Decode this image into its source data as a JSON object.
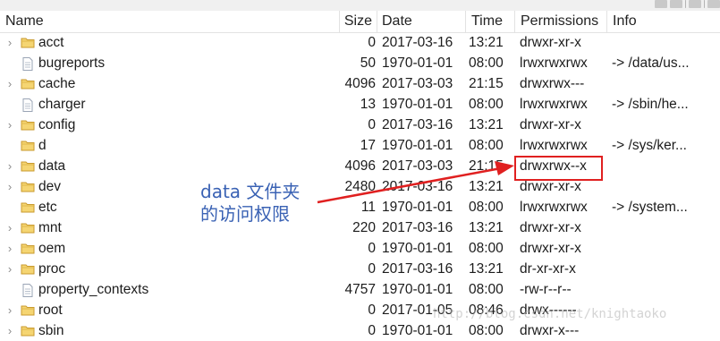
{
  "header": {
    "name": "Name",
    "size": "Size",
    "date": "Date",
    "time": "Time",
    "permissions": "Permissions",
    "info": "Info"
  },
  "rows": [
    {
      "name": "acct",
      "type": "folder",
      "size": "0",
      "date": "2017-03-16",
      "time": "13:21",
      "perm": "drwxr-xr-x",
      "info": ""
    },
    {
      "name": "bugreports",
      "type": "file",
      "size": "50",
      "date": "1970-01-01",
      "time": "08:00",
      "perm": "lrwxrwxrwx",
      "info": "-> /data/us..."
    },
    {
      "name": "cache",
      "type": "folder",
      "size": "4096",
      "date": "2017-03-03",
      "time": "21:15",
      "perm": "drwxrwx---",
      "info": ""
    },
    {
      "name": "charger",
      "type": "file",
      "size": "13",
      "date": "1970-01-01",
      "time": "08:00",
      "perm": "lrwxrwxrwx",
      "info": "-> /sbin/he..."
    },
    {
      "name": "config",
      "type": "folder",
      "size": "0",
      "date": "2017-03-16",
      "time": "13:21",
      "perm": "drwxr-xr-x",
      "info": ""
    },
    {
      "name": "d",
      "type": "folder-noexp",
      "size": "17",
      "date": "1970-01-01",
      "time": "08:00",
      "perm": "lrwxrwxrwx",
      "info": "-> /sys/ker..."
    },
    {
      "name": "data",
      "type": "folder",
      "size": "4096",
      "date": "2017-03-03",
      "time": "21:15",
      "perm": "drwxrwx--x",
      "info": ""
    },
    {
      "name": "dev",
      "type": "folder",
      "size": "2480",
      "date": "2017-03-16",
      "time": "13:21",
      "perm": "drwxr-xr-x",
      "info": ""
    },
    {
      "name": "etc",
      "type": "folder-noexp",
      "size": "11",
      "date": "1970-01-01",
      "time": "08:00",
      "perm": "lrwxrwxrwx",
      "info": "-> /system..."
    },
    {
      "name": "mnt",
      "type": "folder",
      "size": "220",
      "date": "2017-03-16",
      "time": "13:21",
      "perm": "drwxr-xr-x",
      "info": ""
    },
    {
      "name": "oem",
      "type": "folder",
      "size": "0",
      "date": "1970-01-01",
      "time": "08:00",
      "perm": "drwxr-xr-x",
      "info": ""
    },
    {
      "name": "proc",
      "type": "folder",
      "size": "0",
      "date": "2017-03-16",
      "time": "13:21",
      "perm": "dr-xr-xr-x",
      "info": ""
    },
    {
      "name": "property_contexts",
      "type": "file",
      "size": "4757",
      "date": "1970-01-01",
      "time": "08:00",
      "perm": "-rw-r--r--",
      "info": ""
    },
    {
      "name": "root",
      "type": "folder",
      "size": "0",
      "date": "2017-01-05",
      "time": "08:46",
      "perm": "drwx------",
      "info": ""
    },
    {
      "name": "sbin",
      "type": "folder",
      "size": "0",
      "date": "1970-01-01",
      "time": "08:00",
      "perm": "drwxr-x---",
      "info": ""
    }
  ],
  "annotation": {
    "line1": "data 文件夹",
    "line2": "的访问权限",
    "color": "#3a62b4",
    "highlight_color": "#e02020"
  },
  "watermark": "http://blog.csdn.net/knightaoko"
}
